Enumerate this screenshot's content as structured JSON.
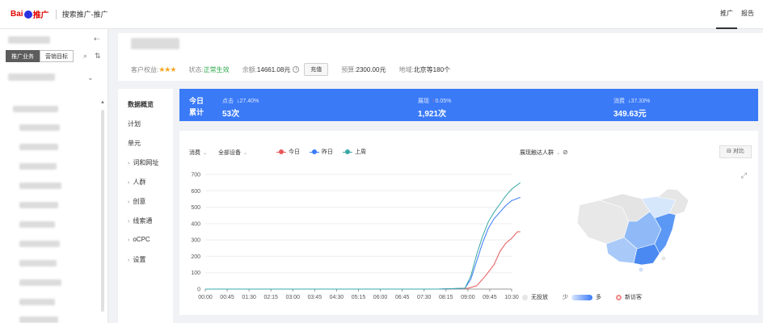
{
  "header": {
    "logo_bai": "Bai",
    "logo_tuiguang": "推广",
    "title": "搜索推广-推广",
    "nav": [
      {
        "label": "推广",
        "active": true
      },
      {
        "label": "报告",
        "active": false
      }
    ]
  },
  "sidebar": {
    "tabs": [
      {
        "label": "推广业务",
        "active": true
      },
      {
        "label": "营销目标",
        "active": false
      }
    ]
  },
  "account": {
    "rights_label": "客户权益:",
    "stars": "★★★",
    "status_label": "状态:",
    "status_value": "正常生效",
    "balance_label": "余额:",
    "balance_value": "14661.08元",
    "recharge_label": "充值",
    "budget_label": "预算:",
    "budget_value": "2300.00元",
    "region_label": "地域:",
    "region_value": "北京等180个"
  },
  "subnav": {
    "items": [
      {
        "label": "数据概览",
        "active": true,
        "caret": false
      },
      {
        "label": "计划",
        "active": false,
        "caret": false
      },
      {
        "label": "单元",
        "active": false,
        "caret": false
      },
      {
        "label": "词和网址",
        "active": false,
        "caret": true
      },
      {
        "label": "人群",
        "active": false,
        "caret": true
      },
      {
        "label": "创意",
        "active": false,
        "caret": true
      },
      {
        "label": "线索通",
        "active": false,
        "caret": true
      },
      {
        "label": "oCPC",
        "active": false,
        "caret": true
      },
      {
        "label": "设置",
        "active": false,
        "caret": true
      }
    ]
  },
  "summary": {
    "today": "今日",
    "cumulative": "累计",
    "metrics": [
      {
        "name": "点击",
        "arrow": "↓",
        "delta": "27.40%",
        "value": "53次"
      },
      {
        "name": "展现",
        "arrow": "↑",
        "delta": "0.05%",
        "value": "1,921次"
      },
      {
        "name": "消费",
        "arrow": "↓",
        "delta": "37.33%",
        "value": "349.63元"
      }
    ]
  },
  "chart_panel": {
    "metric_select": "消费",
    "device_select": "全部设备",
    "map_select": "展现触达人群",
    "compare_label": "对比",
    "map_legend": {
      "no_serve": "无投放",
      "few": "少",
      "many": "多",
      "new_visitor": "新访客"
    }
  },
  "chart_data": {
    "type": "line",
    "x": [
      "00:00",
      "00:45",
      "01:30",
      "02:15",
      "03:00",
      "03:45",
      "04:30",
      "05:15",
      "06:00",
      "06:45",
      "07:30",
      "08:15",
      "09:00",
      "09:45",
      "10:30"
    ],
    "ylim": [
      0,
      700
    ],
    "yticks": [
      0,
      100,
      200,
      300,
      400,
      500,
      600,
      700
    ],
    "grid": true,
    "legend": "top",
    "series": [
      {
        "name": "今日",
        "color": "#e8585a",
        "points": [
          [
            0,
            0
          ],
          [
            8,
            0
          ],
          [
            9,
            5
          ],
          [
            9.3,
            20
          ],
          [
            9.6,
            80
          ],
          [
            9.9,
            150
          ],
          [
            10.1,
            230
          ],
          [
            10.3,
            280
          ],
          [
            10.5,
            310
          ],
          [
            10.7,
            350
          ],
          [
            10.8,
            350
          ]
        ]
      },
      {
        "name": "昨日",
        "color": "#3a7af7",
        "points": [
          [
            0,
            0
          ],
          [
            8,
            0
          ],
          [
            8.9,
            5
          ],
          [
            9.1,
            60
          ],
          [
            9.3,
            170
          ],
          [
            9.5,
            280
          ],
          [
            9.7,
            370
          ],
          [
            9.9,
            430
          ],
          [
            10.1,
            470
          ],
          [
            10.3,
            510
          ],
          [
            10.5,
            540
          ],
          [
            10.8,
            560
          ]
        ]
      },
      {
        "name": "上周",
        "color": "#3aa8a8",
        "points": [
          [
            0,
            0
          ],
          [
            8,
            0
          ],
          [
            8.9,
            5
          ],
          [
            9.1,
            80
          ],
          [
            9.3,
            210
          ],
          [
            9.5,
            320
          ],
          [
            9.7,
            410
          ],
          [
            9.9,
            470
          ],
          [
            10.1,
            520
          ],
          [
            10.3,
            570
          ],
          [
            10.5,
            610
          ],
          [
            10.8,
            650
          ]
        ]
      }
    ]
  }
}
